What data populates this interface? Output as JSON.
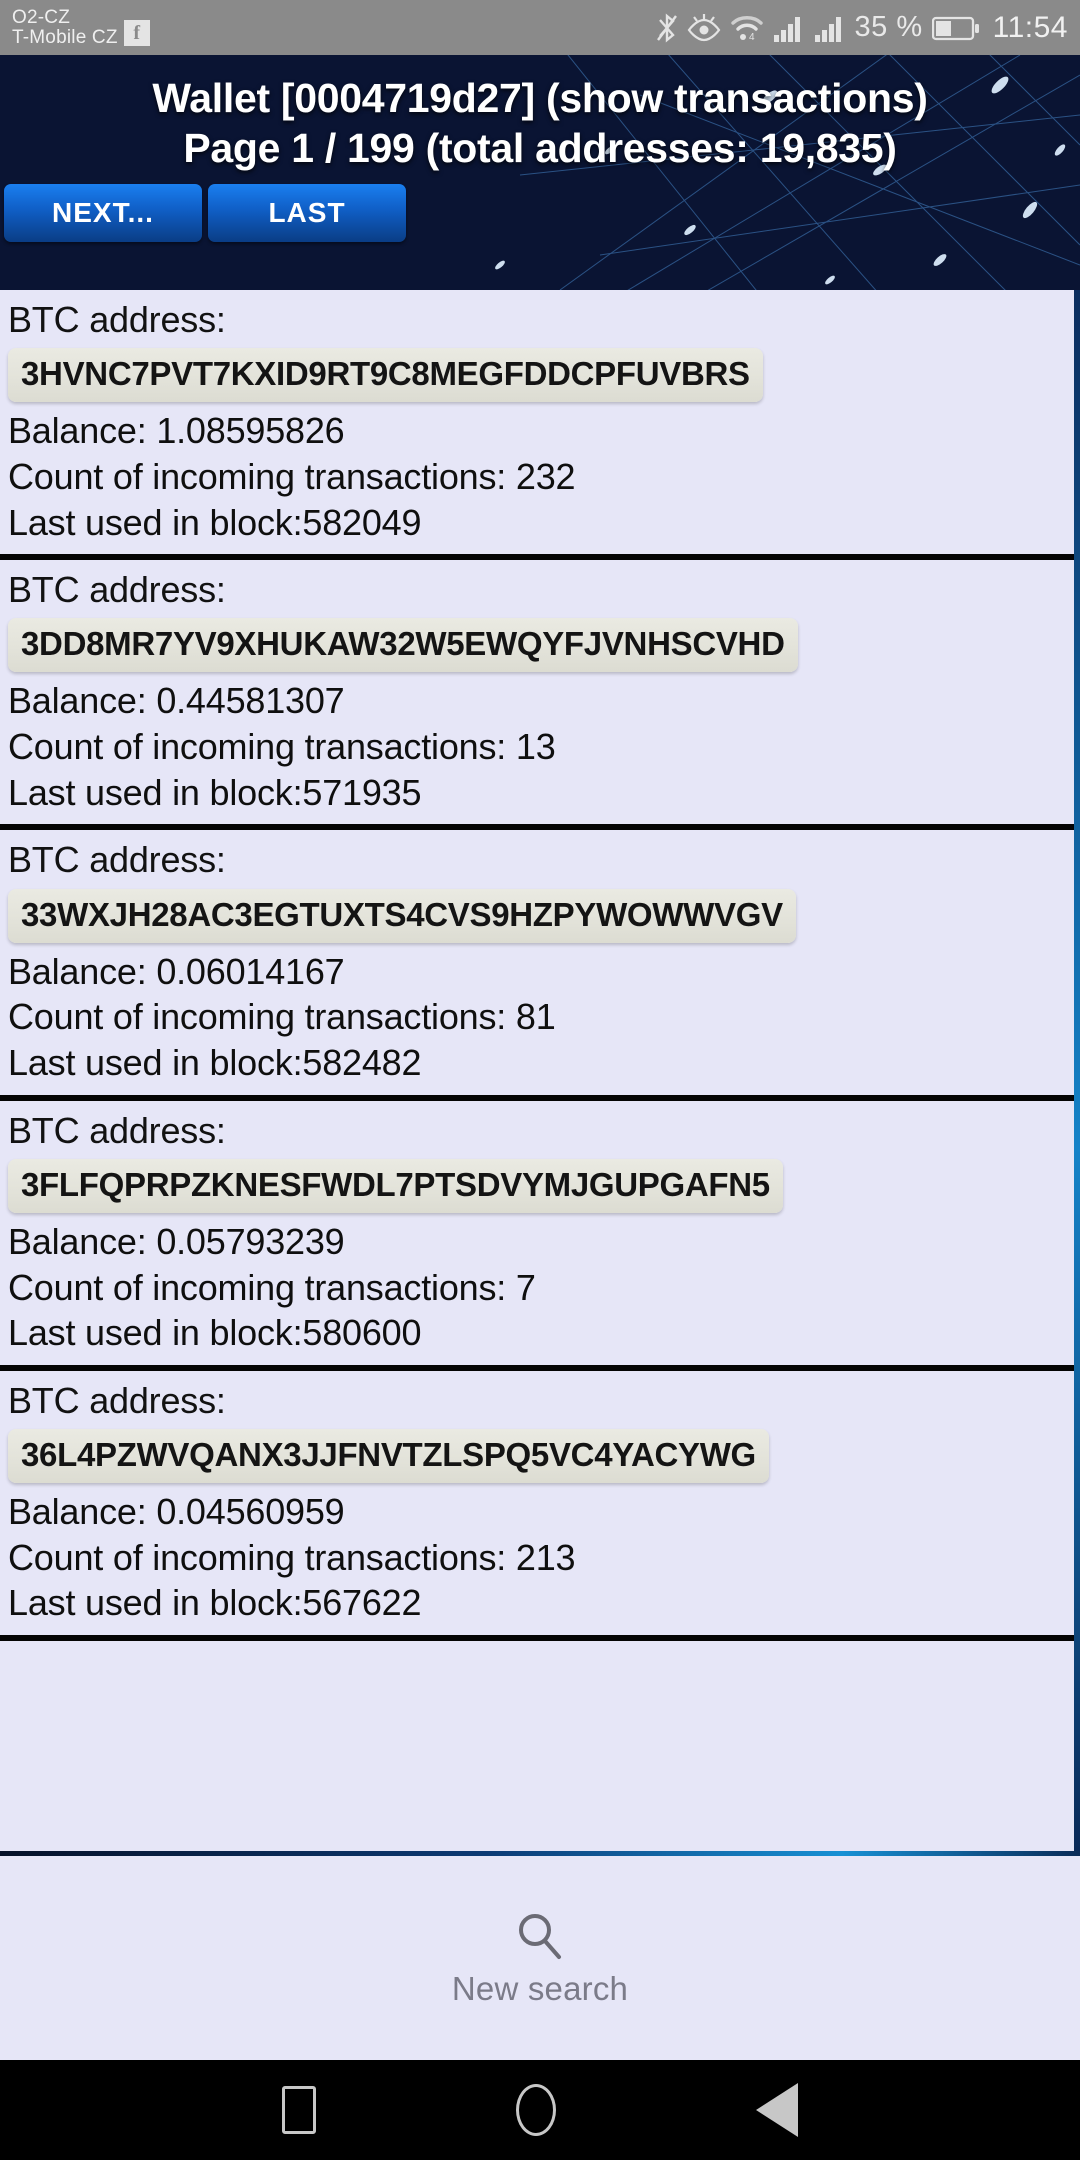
{
  "status_bar": {
    "carrier_primary": "O2-CZ",
    "carrier_secondary": "T-Mobile CZ",
    "notification_icon": "facebook-icon",
    "icons": [
      "bluetooth-icon",
      "eye-comfort-icon",
      "wifi-icon",
      "signal-bars-icon",
      "signal-bars-2-icon"
    ],
    "battery_percent": "35 %",
    "clock": "11:54"
  },
  "header": {
    "title_line1": "Wallet [0004719d27] (show transactions)",
    "title_line2": "Page 1 / 199   (total addresses: 19,835)",
    "buttons": [
      {
        "label": "NEXT...",
        "name": "next-button"
      },
      {
        "label": "LAST",
        "name": "last-button"
      }
    ]
  },
  "labels": {
    "btc_address": "BTC address:",
    "balance_prefix": "Balance: ",
    "count_prefix": "Count of incoming transactions: ",
    "block_prefix": "Last used in block:"
  },
  "addresses": [
    {
      "address": "3HVNC7PVT7KXID9RT9C8MEGFDDCPFUVBRS",
      "balance": "1.08595826",
      "incoming_transactions": "232",
      "last_block": "582049"
    },
    {
      "address": "3DD8MR7YV9XHUKAW32W5EWQYFJVNHSCVHD",
      "balance": "0.44581307",
      "incoming_transactions": "13",
      "last_block": "571935"
    },
    {
      "address": "33WXJH28AC3EGTUXTS4CVS9HZPYWOWWVGV",
      "balance": "0.06014167",
      "incoming_transactions": "81",
      "last_block": "582482"
    },
    {
      "address": "3FLFQPRPZKNESFWDL7PTSDVYMJGUPGAFN5",
      "balance": "0.05793239",
      "incoming_transactions": "7",
      "last_block": "580600"
    },
    {
      "address": "36L4PZWVQANX3JJFNVTZLSPQ5VC4YACYWG",
      "balance": "0.04560959",
      "incoming_transactions": "213",
      "last_block": "567622"
    }
  ],
  "footer": {
    "icon": "search-icon",
    "label": "New search"
  },
  "navbar": {
    "recents": "recents-square-icon",
    "home": "home-circle-icon",
    "back": "back-triangle-icon"
  },
  "colors": {
    "header_blue": "#0a1433",
    "button_blue": "#1060c8",
    "card_bg": "#e6e6f7",
    "chip_bg": "#e3e3da",
    "separator": "#040404",
    "status_bar_bg": "#8a8a8a"
  }
}
